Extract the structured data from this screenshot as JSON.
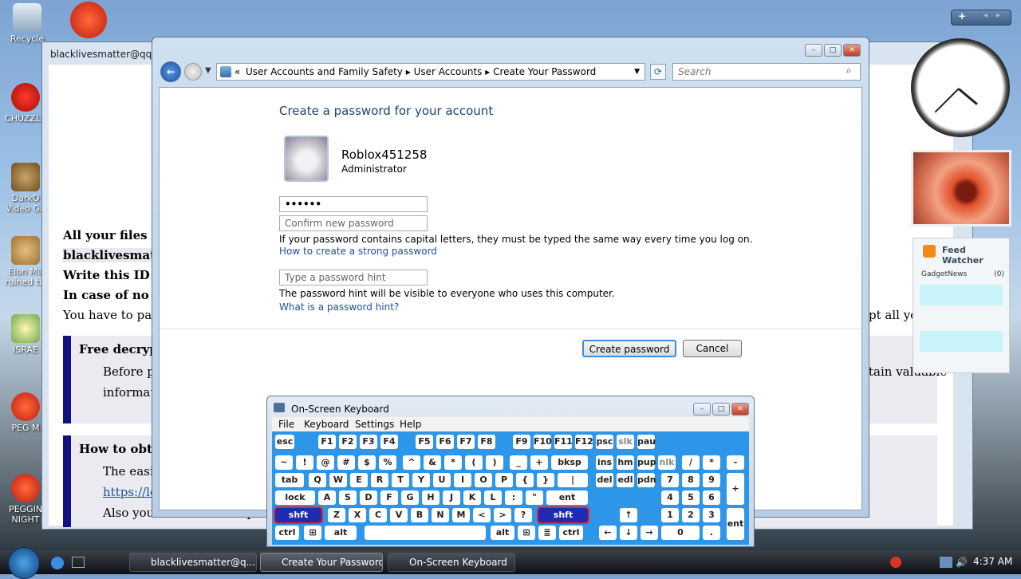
{
  "desktop": {
    "icons": [
      {
        "label": "Recycle"
      },
      {
        "label": "CHUZZLE"
      },
      {
        "label": "DarkO Video Ga"
      },
      {
        "label": "Elon Mu ruined tw"
      },
      {
        "label": "ISRAE"
      },
      {
        "label": "PEG M"
      },
      {
        "label": "PEGGIN NIGHT"
      }
    ]
  },
  "bg_window": {
    "title": "blacklivesmatter@qq.co",
    "lines": [
      "All your files hav",
      "blacklivesmatte",
      "Write this ID in t",
      "In case of no ans",
      "You have to pay f",
      "pt all yo",
      "Free decrypti",
      "Before pay",
      "tain valuable",
      "information",
      "How to obtain",
      "The easies",
      "https://loc",
      "Also you can find other places to"
    ]
  },
  "cp_window": {
    "breadcrumb": [
      "User Accounts and Family Safety",
      "User Accounts",
      "Create Your Password"
    ],
    "search_placeholder": "Search",
    "heading": "Create a password for your account",
    "user_name": "Roblox451258",
    "user_role": "Administrator",
    "password_value": "••••••",
    "confirm_placeholder": "Confirm new password",
    "caps_note": "If your password contains capital letters, they must be typed the same way every time you log on.",
    "strong_link": "How to create a strong password",
    "hint_placeholder": "Type a password hint",
    "hint_note": "The password hint will be visible to everyone who uses this computer.",
    "hint_link": "What is a password hint?",
    "create_button": "Create password",
    "cancel_button": "Cancel"
  },
  "gadgets": {
    "feed_title": "Feed Watcher",
    "feed_item": "GadgetNews",
    "feed_count": "(0)"
  },
  "osk": {
    "title": "On-Screen Keyboard",
    "menu": [
      "File",
      "Keyboard",
      "Settings",
      "Help"
    ]
  },
  "taskbar": {
    "tasks": [
      "blacklivesmatter@q...",
      "Create Your Password",
      "On-Screen Keyboard"
    ],
    "time": "4:37 AM"
  }
}
